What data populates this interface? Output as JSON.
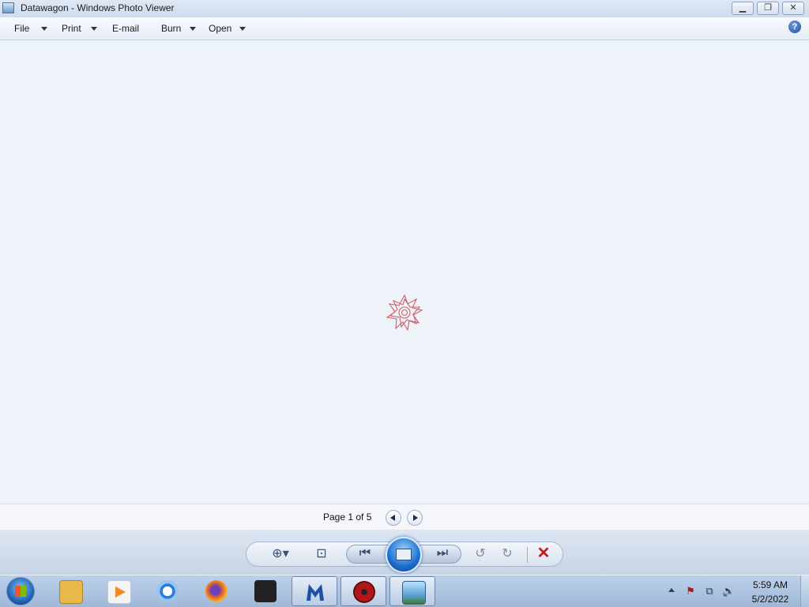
{
  "window": {
    "title": "Datawagon - Windows Photo Viewer",
    "controls": {
      "minimize": "▁",
      "maximize": "❐",
      "close": "✕"
    }
  },
  "menu": {
    "items": [
      {
        "label": "File",
        "has_dropdown": true
      },
      {
        "label": "Print",
        "has_dropdown": true
      },
      {
        "label": "E-mail",
        "has_dropdown": false
      },
      {
        "label": "Burn",
        "has_dropdown": true
      },
      {
        "label": "Open",
        "has_dropdown": true
      }
    ],
    "help_icon": "help-icon",
    "help_glyph": "?"
  },
  "viewer": {
    "content": "loading-star-graphic"
  },
  "page_nav": {
    "label": "Page 1 of 5",
    "prev_icon": "prev-page-icon",
    "next_icon": "next-page-icon"
  },
  "toolbar": {
    "zoom_icon": "zoom-icon",
    "zoom_glyph": "⊕▾",
    "actual_size_icon": "fit-window-icon",
    "actual_size_glyph": "⊡",
    "previous_icon": "previous-image-icon",
    "previous_glyph": "⏮",
    "slideshow_icon": "slideshow-icon",
    "next_icon": "next-image-icon",
    "next_glyph": "⏭",
    "rotate_ccw_icon": "rotate-counterclockwise-icon",
    "rotate_ccw_glyph": "↺",
    "rotate_cw_icon": "rotate-clockwise-icon",
    "rotate_cw_glyph": "↻",
    "delete_icon": "delete-icon",
    "delete_glyph": "✕"
  },
  "taskbar": {
    "start": "start-button",
    "pinned": [
      {
        "name": "file-explorer-icon",
        "color": "#e8b94a"
      },
      {
        "name": "media-player-icon",
        "color": "#f08a24"
      },
      {
        "name": "chrome-icon",
        "color": "#2a7be4"
      },
      {
        "name": "firefox-icon",
        "color": "#e86a1f"
      },
      {
        "name": "mpc-be-icon",
        "color": "#222222"
      },
      {
        "name": "malwarebytes-icon",
        "color": "#1b4fa8"
      },
      {
        "name": "radiation-app-icon",
        "color": "#b0161a"
      },
      {
        "name": "photo-viewer-icon",
        "color": "#5aa2d6"
      }
    ],
    "tray": {
      "show_hidden": "show-hidden-icons",
      "flag_glyph": "⚑",
      "network_glyph": "⧉",
      "volume_glyph": "🔊",
      "time": "5:59 AM",
      "date": "5/2/2022"
    }
  }
}
